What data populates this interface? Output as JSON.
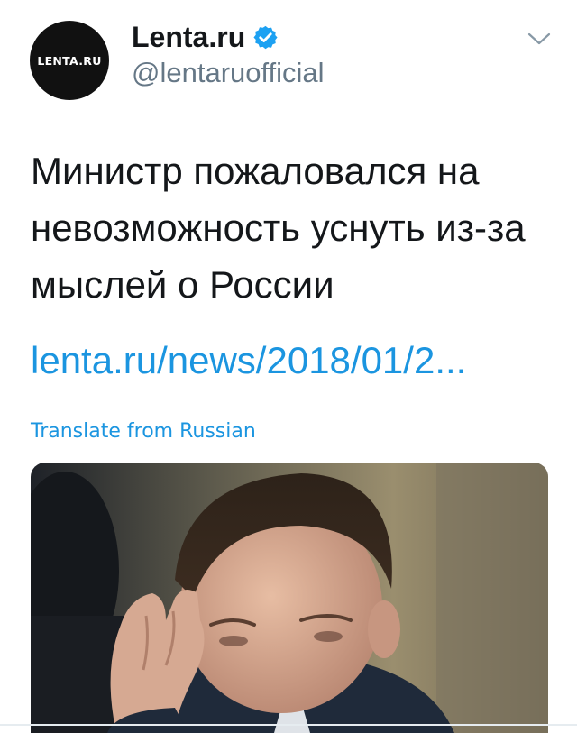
{
  "account": {
    "avatar_text": "LENTA.RU",
    "display_name": "Lenta.ru",
    "handle": "@lentaruofficial",
    "verified": true
  },
  "tweet": {
    "text": "Министр пожаловался на невозможность уснуть из-за мыслей о России",
    "link": "lenta.ru/news/2018/01/2...",
    "translate_label": "Translate from Russian"
  },
  "icons": {
    "verified": "verified-badge-icon",
    "menu": "chevron-down-icon"
  },
  "colors": {
    "text": "#14171a",
    "secondary": "#657786",
    "link": "#1b95e0",
    "verified": "#1da1f2",
    "avatar_bg": "#111111"
  }
}
